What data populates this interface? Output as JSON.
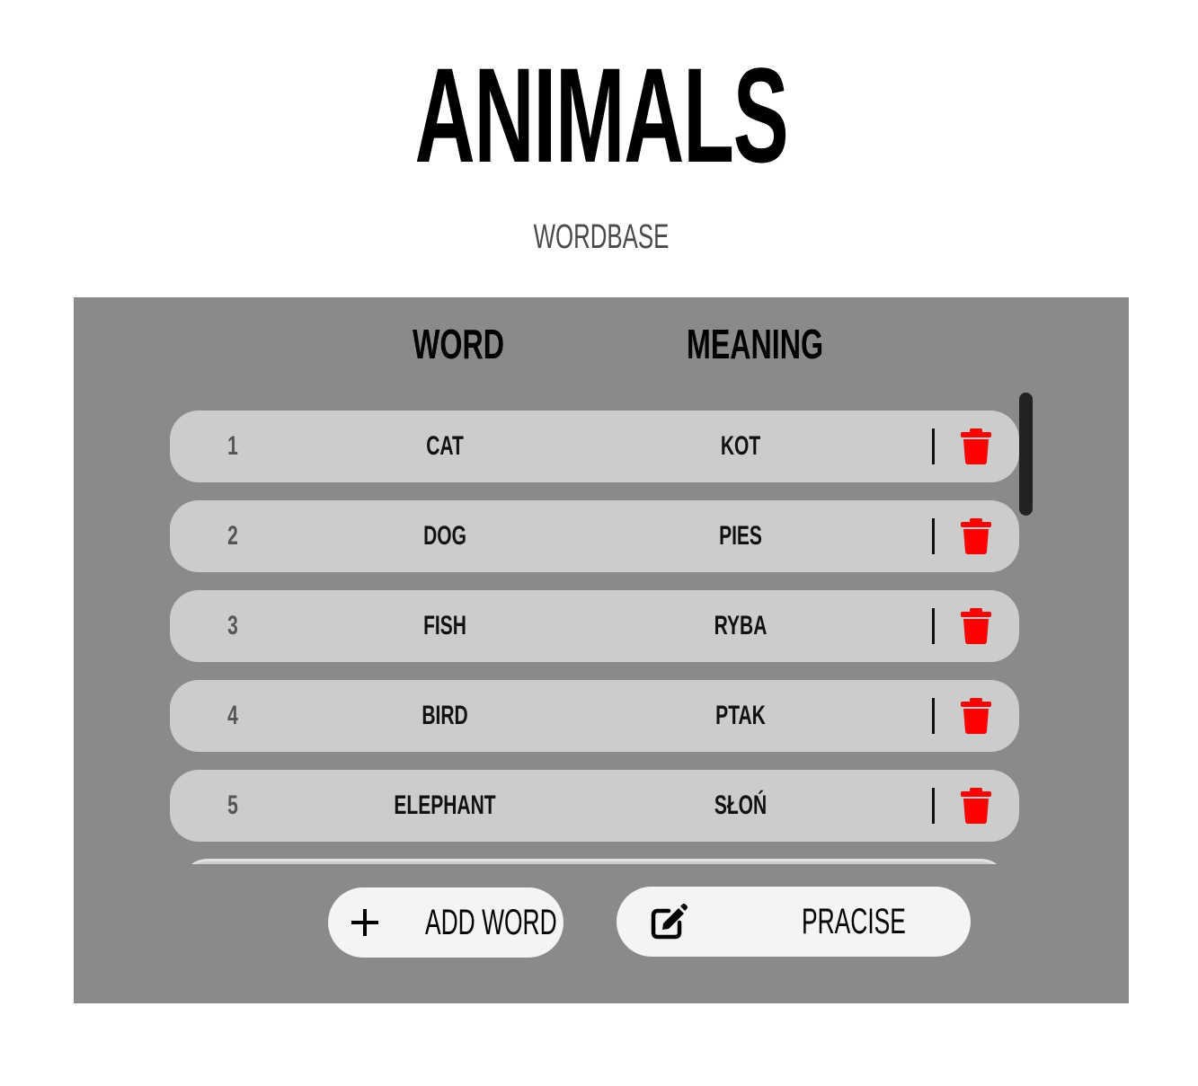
{
  "title": "ANIMALS",
  "subtitle": "WORDBASE",
  "columns": {
    "word": "WORD",
    "meaning": "MEANING"
  },
  "rows": [
    {
      "num": "1",
      "word": "CAT",
      "meaning": "KOT"
    },
    {
      "num": "2",
      "word": "DOG",
      "meaning": "PIES"
    },
    {
      "num": "3",
      "word": "FISH",
      "meaning": "RYBA"
    },
    {
      "num": "4",
      "word": "BIRD",
      "meaning": "PTAK"
    },
    {
      "num": "5",
      "word": "ELEPHANT",
      "meaning": "SŁOŃ"
    }
  ],
  "buttons": {
    "add_label": "ADD WORD",
    "practise_label": "PRACISE"
  },
  "icons": {
    "row_delete": "trash-icon",
    "add": "plus-icon",
    "practise": "edit-icon"
  },
  "colors": {
    "panel": "#8a8a8a",
    "row": "#cccccc",
    "button": "#f4f4f4",
    "delete": "#ff0000"
  }
}
